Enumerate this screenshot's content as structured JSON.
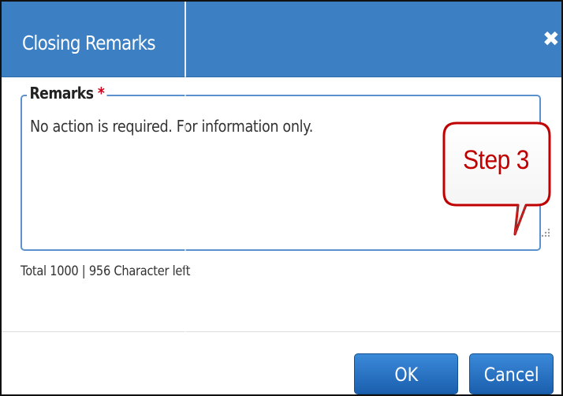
{
  "dialog": {
    "title": "Closing Remarks",
    "close_icon": "close-icon"
  },
  "remarks": {
    "label": "Remarks",
    "required_marker": "*",
    "value": "No action is required. For information only."
  },
  "counter": {
    "text": "Total 1000 | 956 Character left"
  },
  "callout": {
    "text": "Step 3"
  },
  "buttons": {
    "ok_label": "OK",
    "cancel_label": "Cancel"
  },
  "colors": {
    "title_bar": "#3c7fc2",
    "button": "#1a5fae",
    "callout_border": "#c00000",
    "required": "#d0021b"
  }
}
